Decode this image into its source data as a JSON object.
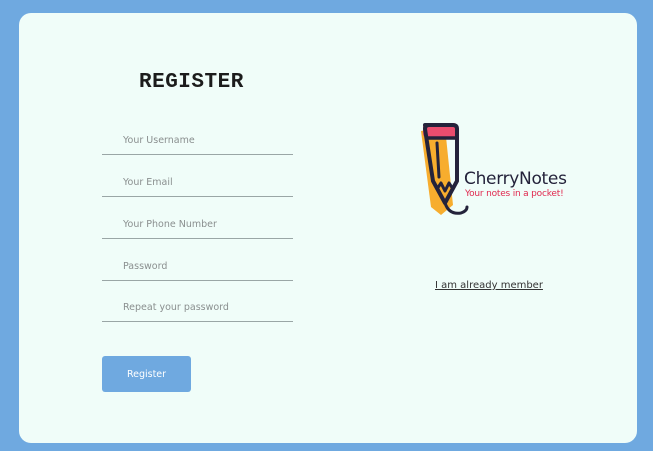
{
  "form": {
    "title": "REGISTER",
    "fields": [
      {
        "name": "username",
        "placeholder": "Your Username",
        "value": ""
      },
      {
        "name": "email",
        "placeholder": "Your Email",
        "value": ""
      },
      {
        "name": "phone",
        "placeholder": "Your Phone Number",
        "value": ""
      },
      {
        "name": "password",
        "placeholder": "Password",
        "value": ""
      },
      {
        "name": "repeat_password",
        "placeholder": "Repeat your password",
        "value": ""
      }
    ],
    "submit_label": "Register"
  },
  "brand": {
    "name": "CherryNotes",
    "tagline": "Your notes in a pocket!",
    "logo_icon": "pencil-icon"
  },
  "links": {
    "already_member": "I am already member"
  },
  "colors": {
    "page_background": "#6fa9e0",
    "card_background": "#f0fdf9",
    "button": "#6fa9e0",
    "brand_accent": "#e0294f",
    "pencil_body": "#f7ad2e",
    "pencil_dark": "#24233b"
  }
}
